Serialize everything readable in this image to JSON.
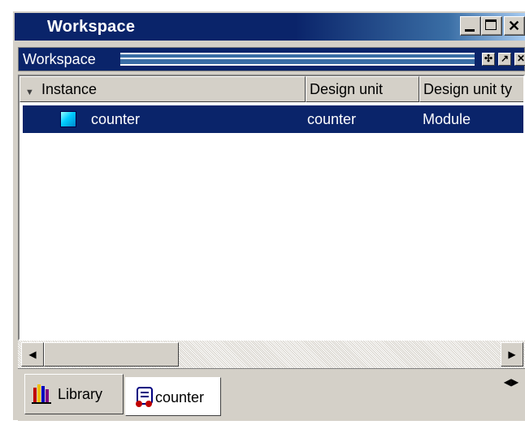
{
  "window": {
    "title": "Workspace",
    "controls": {
      "minimize": "minimize",
      "maximize": "maximize",
      "close": "close"
    }
  },
  "pane": {
    "title": "Workspace",
    "buttons": [
      "pin-icon",
      "undock-icon",
      "close-icon"
    ]
  },
  "table": {
    "columns": [
      "Instance",
      "Design unit",
      "Design unit ty"
    ],
    "rows": [
      {
        "instance": "counter",
        "design_unit": "counter",
        "design_unit_type": "Module",
        "icon": "module-icon",
        "selected": true
      }
    ]
  },
  "tabs": [
    {
      "label": "Library",
      "icon": "library-icon",
      "active": false
    },
    {
      "label": "counter",
      "icon": "sim-icon",
      "active": true
    }
  ],
  "colors": {
    "titlebar": "#0a246a",
    "selection": "#0a246a",
    "chrome": "#d4d0c8"
  }
}
